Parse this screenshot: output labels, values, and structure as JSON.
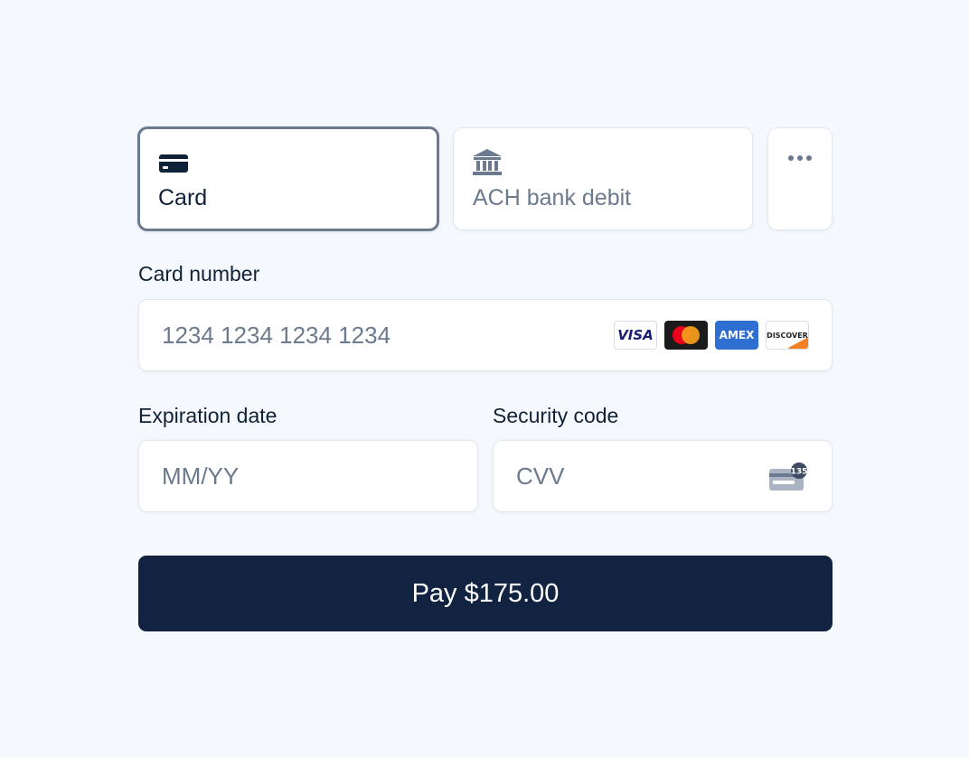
{
  "tabs": [
    {
      "label": "Card",
      "icon": "credit-card-icon",
      "selected": true
    },
    {
      "label": "ACH bank debit",
      "icon": "bank-icon",
      "selected": false
    },
    {
      "label": "",
      "icon": "more-icon",
      "selected": false
    }
  ],
  "card_number": {
    "label": "Card number",
    "placeholder": "1234 1234 1234 1234",
    "value": ""
  },
  "brands": [
    {
      "name": "visa-logo",
      "text": "VISA"
    },
    {
      "name": "mastercard-logo",
      "text": ""
    },
    {
      "name": "amex-logo",
      "text": "AMEX"
    },
    {
      "name": "discover-logo",
      "text": "DISCOVER"
    }
  ],
  "expiration": {
    "label": "Expiration date",
    "placeholder": "MM/YY",
    "value": ""
  },
  "security": {
    "label": "Security code",
    "placeholder": "CVV",
    "value": "",
    "icon_badge": "135"
  },
  "pay_button": {
    "label": "Pay $175.00"
  },
  "colors": {
    "background": "#f5f8fc",
    "primary": "#112340",
    "text": "#102238",
    "placeholder": "#6c7a8e",
    "selected_border": "#6b7a8f"
  }
}
